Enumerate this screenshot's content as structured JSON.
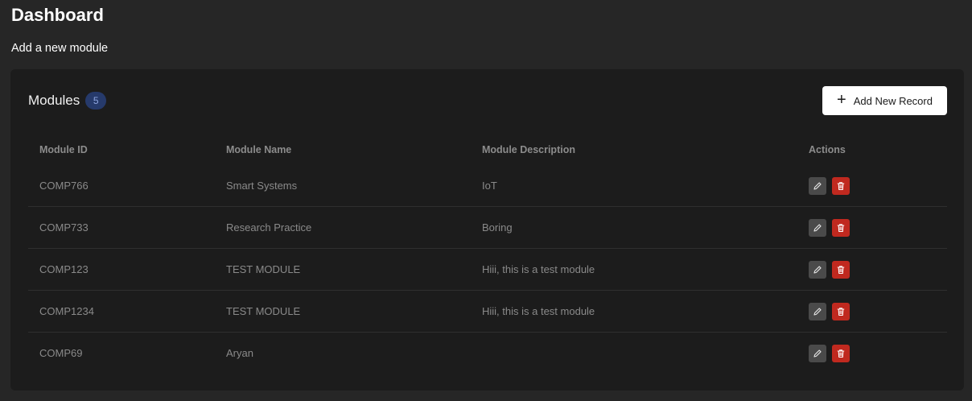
{
  "page": {
    "title": "Dashboard",
    "add_link": "Add a new module"
  },
  "card": {
    "title": "Modules",
    "count": "5",
    "add_button_label": "Add New Record",
    "add_button_icon": "plus-icon"
  },
  "table": {
    "headers": [
      "Module ID",
      "Module Name",
      "Module Description",
      "Actions"
    ],
    "rows": [
      {
        "id": "COMP766",
        "name": "Smart Systems",
        "description": "IoT"
      },
      {
        "id": "COMP733",
        "name": "Research Practice",
        "description": "Boring"
      },
      {
        "id": "COMP123",
        "name": "TEST MODULE",
        "description": "Hiii, this is a test module"
      },
      {
        "id": "COMP1234",
        "name": "TEST MODULE",
        "description": "Hiii, this is a test module"
      },
      {
        "id": "COMP69",
        "name": "Aryan",
        "description": ""
      }
    ],
    "row_actions": [
      {
        "icon": "pencil-icon",
        "color": "#4a4a4a"
      },
      {
        "icon": "trash-icon",
        "color": "#c0291f"
      }
    ]
  },
  "colors": {
    "background": "#262626",
    "card": "#1c1c1c",
    "badge_bg": "#263a6b",
    "badge_text": "#8fa6df",
    "delete": "#c0291f",
    "edit": "#4a4a4a"
  }
}
